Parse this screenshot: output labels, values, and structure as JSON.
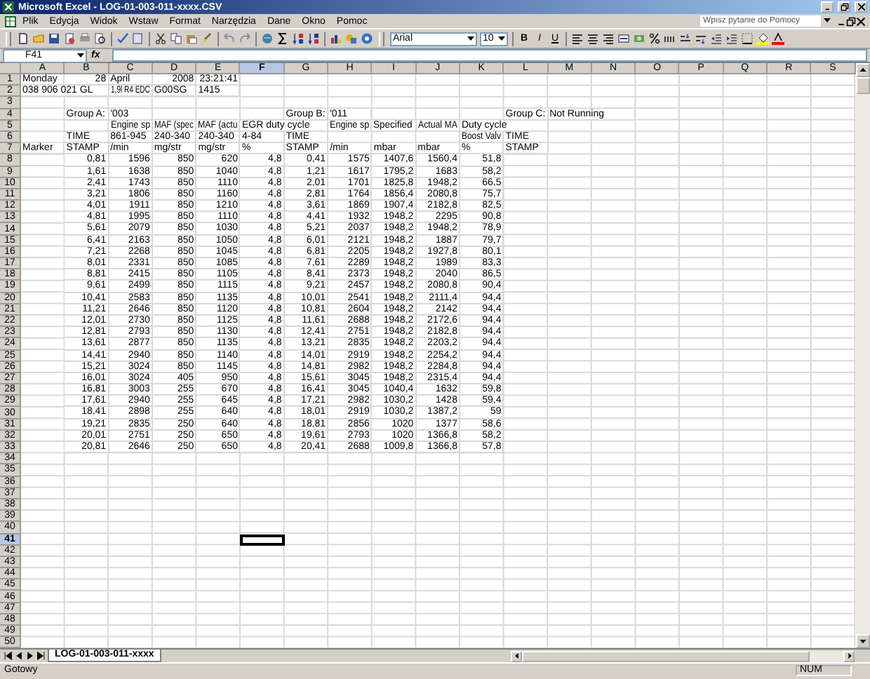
{
  "window": {
    "title": "Microsoft Excel - LOG-01-003-011-xxxx.CSV"
  },
  "menu": [
    "Plik",
    "Edycja",
    "Widok",
    "Wstaw",
    "Format",
    "Narzędzia",
    "Dane",
    "Okno",
    "Pomoc"
  ],
  "help_search": {
    "placeholder": "Wpisz pytanie do Pomocy"
  },
  "formatting": {
    "font": "Arial",
    "size": "10",
    "style_buttons": [
      "B",
      "I",
      "U"
    ]
  },
  "formula_bar": {
    "name_box": "F41",
    "function_label": "fx"
  },
  "columns": [
    {
      "label": "A",
      "selected": false
    },
    {
      "label": "B",
      "selected": false
    },
    {
      "label": "C",
      "selected": false
    },
    {
      "label": "D",
      "selected": false
    },
    {
      "label": "E",
      "selected": false
    },
    {
      "label": "F",
      "selected": true
    },
    {
      "label": "G",
      "selected": false
    },
    {
      "label": "H",
      "selected": false
    },
    {
      "label": "I",
      "selected": false
    },
    {
      "label": "J",
      "selected": false
    },
    {
      "label": "K",
      "selected": false
    },
    {
      "label": "L",
      "selected": false
    },
    {
      "label": "M",
      "selected": false
    },
    {
      "label": "N",
      "selected": false
    },
    {
      "label": "O",
      "selected": false
    },
    {
      "label": "P",
      "selected": false
    },
    {
      "label": "Q",
      "selected": false
    },
    {
      "label": "R",
      "selected": false
    },
    {
      "label": "S",
      "selected": false
    }
  ],
  "rows": [
    {
      "label": "1",
      "selected": false,
      "numeric": false,
      "cells": [
        "Monday",
        {
          "v": "28",
          "right": true
        },
        "April",
        {
          "v": "2008",
          "right": true
        },
        {
          "v": "23:21:41",
          "right": true
        }
      ]
    },
    {
      "label": "2",
      "selected": false,
      "numeric": false,
      "cells": [
        "038 906 021 GL",
        null,
        "1,9l R4 EDC",
        "G00SG",
        "1415"
      ]
    },
    {
      "label": "3",
      "selected": false
    },
    {
      "label": "4",
      "selected": false,
      "numeric": false,
      "cells": [
        null,
        "Group A:",
        "'003",
        null,
        null,
        null,
        "Group B:",
        "'011",
        null,
        null,
        null,
        "Group C:",
        "Not Running"
      ]
    },
    {
      "label": "5",
      "selected": false,
      "numeric": false,
      "cells": [
        null,
        null,
        "Engine sp",
        "MAF (spec",
        "MAF (actu",
        "EGR duty cycle",
        null,
        "Engine sp",
        "Specified",
        "Actual MA",
        "Duty cycle"
      ]
    },
    {
      "label": "6",
      "selected": false,
      "numeric": false,
      "cells": [
        null,
        "TIME",
        "861-945",
        "240-340",
        "240-340",
        "4-84",
        "TIME",
        null,
        null,
        null,
        "Boost Valv",
        "TIME"
      ]
    },
    {
      "label": "7",
      "selected": false,
      "numeric": false,
      "cells": [
        "Marker",
        "STAMP",
        "/min",
        "mg/str",
        "mg/str",
        "%",
        "STAMP",
        "/min",
        "mbar",
        "mbar",
        "%",
        "STAMP"
      ]
    },
    {
      "label": "8",
      "selected": false,
      "numeric": true,
      "cells": [
        null,
        "0,81",
        "1596",
        "850",
        "620",
        "4,8",
        "0,41",
        "1575",
        "1407,6",
        "1560,4",
        "51,8"
      ]
    },
    {
      "label": "9",
      "selected": false,
      "numeric": true,
      "cells": [
        null,
        "1,61",
        "1638",
        "850",
        "1040",
        "4,8",
        "1,21",
        "1617",
        "1795,2",
        "1683",
        "58,2"
      ]
    },
    {
      "label": "10",
      "selected": false,
      "numeric": true,
      "cells": [
        null,
        "2,41",
        "1743",
        "850",
        "1110",
        "4,8",
        "2,01",
        "1701",
        "1825,8",
        "1948,2",
        "66,5"
      ]
    },
    {
      "label": "11",
      "selected": false,
      "numeric": true,
      "cells": [
        null,
        "3,21",
        "1806",
        "850",
        "1160",
        "4,8",
        "2,81",
        "1764",
        "1856,4",
        "2080,8",
        "75,7"
      ]
    },
    {
      "label": "12",
      "selected": false,
      "numeric": true,
      "cells": [
        null,
        "4,01",
        "1911",
        "850",
        "1210",
        "4,8",
        "3,61",
        "1869",
        "1907,4",
        "2182,8",
        "82,5"
      ]
    },
    {
      "label": "13",
      "selected": false,
      "numeric": true,
      "cells": [
        null,
        "4,81",
        "1995",
        "850",
        "1110",
        "4,8",
        "4,41",
        "1932",
        "1948,2",
        "2295",
        "90,8"
      ]
    },
    {
      "label": "14",
      "selected": false,
      "numeric": true,
      "cells": [
        null,
        "5,61",
        "2079",
        "850",
        "1030",
        "4,8",
        "5,21",
        "2037",
        "1948,2",
        "1948,2",
        "78,9"
      ]
    },
    {
      "label": "15",
      "selected": false,
      "numeric": true,
      "cells": [
        null,
        "6,41",
        "2163",
        "850",
        "1050",
        "4,8",
        "6,01",
        "2121",
        "1948,2",
        "1887",
        "79,7"
      ]
    },
    {
      "label": "16",
      "selected": false,
      "numeric": true,
      "cells": [
        null,
        "7,21",
        "2268",
        "850",
        "1045",
        "4,8",
        "6,81",
        "2205",
        "1948,2",
        "1927,8",
        "80,1"
      ]
    },
    {
      "label": "17",
      "selected": false,
      "numeric": true,
      "cells": [
        null,
        "8,01",
        "2331",
        "850",
        "1085",
        "4,8",
        "7,61",
        "2289",
        "1948,2",
        "1989",
        "83,3"
      ]
    },
    {
      "label": "18",
      "selected": false,
      "numeric": true,
      "cells": [
        null,
        "8,81",
        "2415",
        "850",
        "1105",
        "4,8",
        "8,41",
        "2373",
        "1948,2",
        "2040",
        "86,5"
      ]
    },
    {
      "label": "19",
      "selected": false,
      "numeric": true,
      "cells": [
        null,
        "9,61",
        "2499",
        "850",
        "1115",
        "4,8",
        "9,21",
        "2457",
        "1948,2",
        "2080,8",
        "90,4"
      ]
    },
    {
      "label": "20",
      "selected": false,
      "numeric": true,
      "cells": [
        null,
        "10,41",
        "2583",
        "850",
        "1135",
        "4,8",
        "10,01",
        "2541",
        "1948,2",
        "2111,4",
        "94,4"
      ]
    },
    {
      "label": "21",
      "selected": false,
      "numeric": true,
      "cells": [
        null,
        "11,21",
        "2646",
        "850",
        "1120",
        "4,8",
        "10,81",
        "2604",
        "1948,2",
        "2142",
        "94,4"
      ]
    },
    {
      "label": "22",
      "selected": false,
      "numeric": true,
      "cells": [
        null,
        "12,01",
        "2730",
        "850",
        "1125",
        "4,8",
        "11,61",
        "2688",
        "1948,2",
        "2172,6",
        "94,4"
      ]
    },
    {
      "label": "23",
      "selected": false,
      "numeric": true,
      "cells": [
        null,
        "12,81",
        "2793",
        "850",
        "1130",
        "4,8",
        "12,41",
        "2751",
        "1948,2",
        "2182,8",
        "94,4"
      ]
    },
    {
      "label": "24",
      "selected": false,
      "numeric": true,
      "cells": [
        null,
        "13,61",
        "2877",
        "850",
        "1135",
        "4,8",
        "13,21",
        "2835",
        "1948,2",
        "2203,2",
        "94,4"
      ]
    },
    {
      "label": "25",
      "selected": false,
      "numeric": true,
      "cells": [
        null,
        "14,41",
        "2940",
        "850",
        "1140",
        "4,8",
        "14,01",
        "2919",
        "1948,2",
        "2254,2",
        "94,4"
      ]
    },
    {
      "label": "26",
      "selected": false,
      "numeric": true,
      "cells": [
        null,
        "15,21",
        "3024",
        "850",
        "1145",
        "4,8",
        "14,81",
        "2982",
        "1948,2",
        "2284,8",
        "94,4"
      ]
    },
    {
      "label": "27",
      "selected": false,
      "numeric": true,
      "cells": [
        null,
        "16,01",
        "3024",
        "405",
        "950",
        "4,8",
        "15,61",
        "3045",
        "1948,2",
        "2315,4",
        "94,4"
      ]
    },
    {
      "label": "28",
      "selected": false,
      "numeric": true,
      "cells": [
        null,
        "16,81",
        "3003",
        "255",
        "670",
        "4,8",
        "16,41",
        "3045",
        "1040,4",
        "1632",
        "59,8"
      ]
    },
    {
      "label": "29",
      "selected": false,
      "numeric": true,
      "cells": [
        null,
        "17,61",
        "2940",
        "255",
        "645",
        "4,8",
        "17,21",
        "2982",
        "1030,2",
        "1428",
        "59,4"
      ]
    },
    {
      "label": "30",
      "selected": false,
      "numeric": true,
      "cells": [
        null,
        "18,41",
        "2898",
        "255",
        "640",
        "4,8",
        "18,01",
        "2919",
        "1030,2",
        "1387,2",
        "59"
      ]
    },
    {
      "label": "31",
      "selected": false,
      "numeric": true,
      "cells": [
        null,
        "19,21",
        "2835",
        "250",
        "640",
        "4,8",
        "18,81",
        "2856",
        "1020",
        "1377",
        "58,6"
      ]
    },
    {
      "label": "32",
      "selected": false,
      "numeric": true,
      "cells": [
        null,
        "20,01",
        "2751",
        "250",
        "650",
        "4,8",
        "19,61",
        "2793",
        "1020",
        "1366,8",
        "58,2"
      ]
    },
    {
      "label": "33",
      "selected": false,
      "numeric": true,
      "cells": [
        null,
        "20,81",
        "2646",
        "250",
        "650",
        "4,8",
        "20,41",
        "2688",
        "1009,8",
        "1366,8",
        "57,8"
      ]
    },
    {
      "label": "34",
      "selected": false
    },
    {
      "label": "35",
      "selected": false
    },
    {
      "label": "36",
      "selected": false
    },
    {
      "label": "37",
      "selected": false
    },
    {
      "label": "38",
      "selected": false
    },
    {
      "label": "39",
      "selected": false
    },
    {
      "label": "40",
      "selected": false
    },
    {
      "label": "41",
      "selected": true
    },
    {
      "label": "42",
      "selected": false
    },
    {
      "label": "43",
      "selected": false
    },
    {
      "label": "44",
      "selected": false
    },
    {
      "label": "45",
      "selected": false
    },
    {
      "label": "46",
      "selected": false
    },
    {
      "label": "47",
      "selected": false
    },
    {
      "label": "48",
      "selected": false
    },
    {
      "label": "49",
      "selected": false
    },
    {
      "label": "50",
      "selected": false
    }
  ],
  "sheet_tabs": [
    {
      "label": "LOG-01-003-011-xxxx",
      "selected": true
    }
  ],
  "status_bar": {
    "message": "Gotowy",
    "indicator": "NUM"
  }
}
